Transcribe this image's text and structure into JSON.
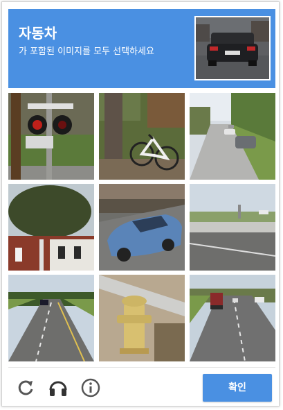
{
  "header": {
    "title": "자동차",
    "subtitle": "가 포함된 이미지를 모두 선택하세요",
    "background": "#4a90e2"
  },
  "tiles": [
    {
      "scene": "railroad-crossing-signal"
    },
    {
      "scene": "bicycle-by-tree"
    },
    {
      "scene": "street-parked-cars"
    },
    {
      "scene": "tree-and-house"
    },
    {
      "scene": "blue-sedan"
    },
    {
      "scene": "highway-overpass"
    },
    {
      "scene": "road-with-car"
    },
    {
      "scene": "fire-hydrant"
    },
    {
      "scene": "highway-truck"
    }
  ],
  "footer": {
    "reload_icon": "reload-icon",
    "audio_icon": "headphones-icon",
    "info_icon": "info-icon",
    "verify_label": "확인",
    "button_color": "#4a90e2"
  }
}
